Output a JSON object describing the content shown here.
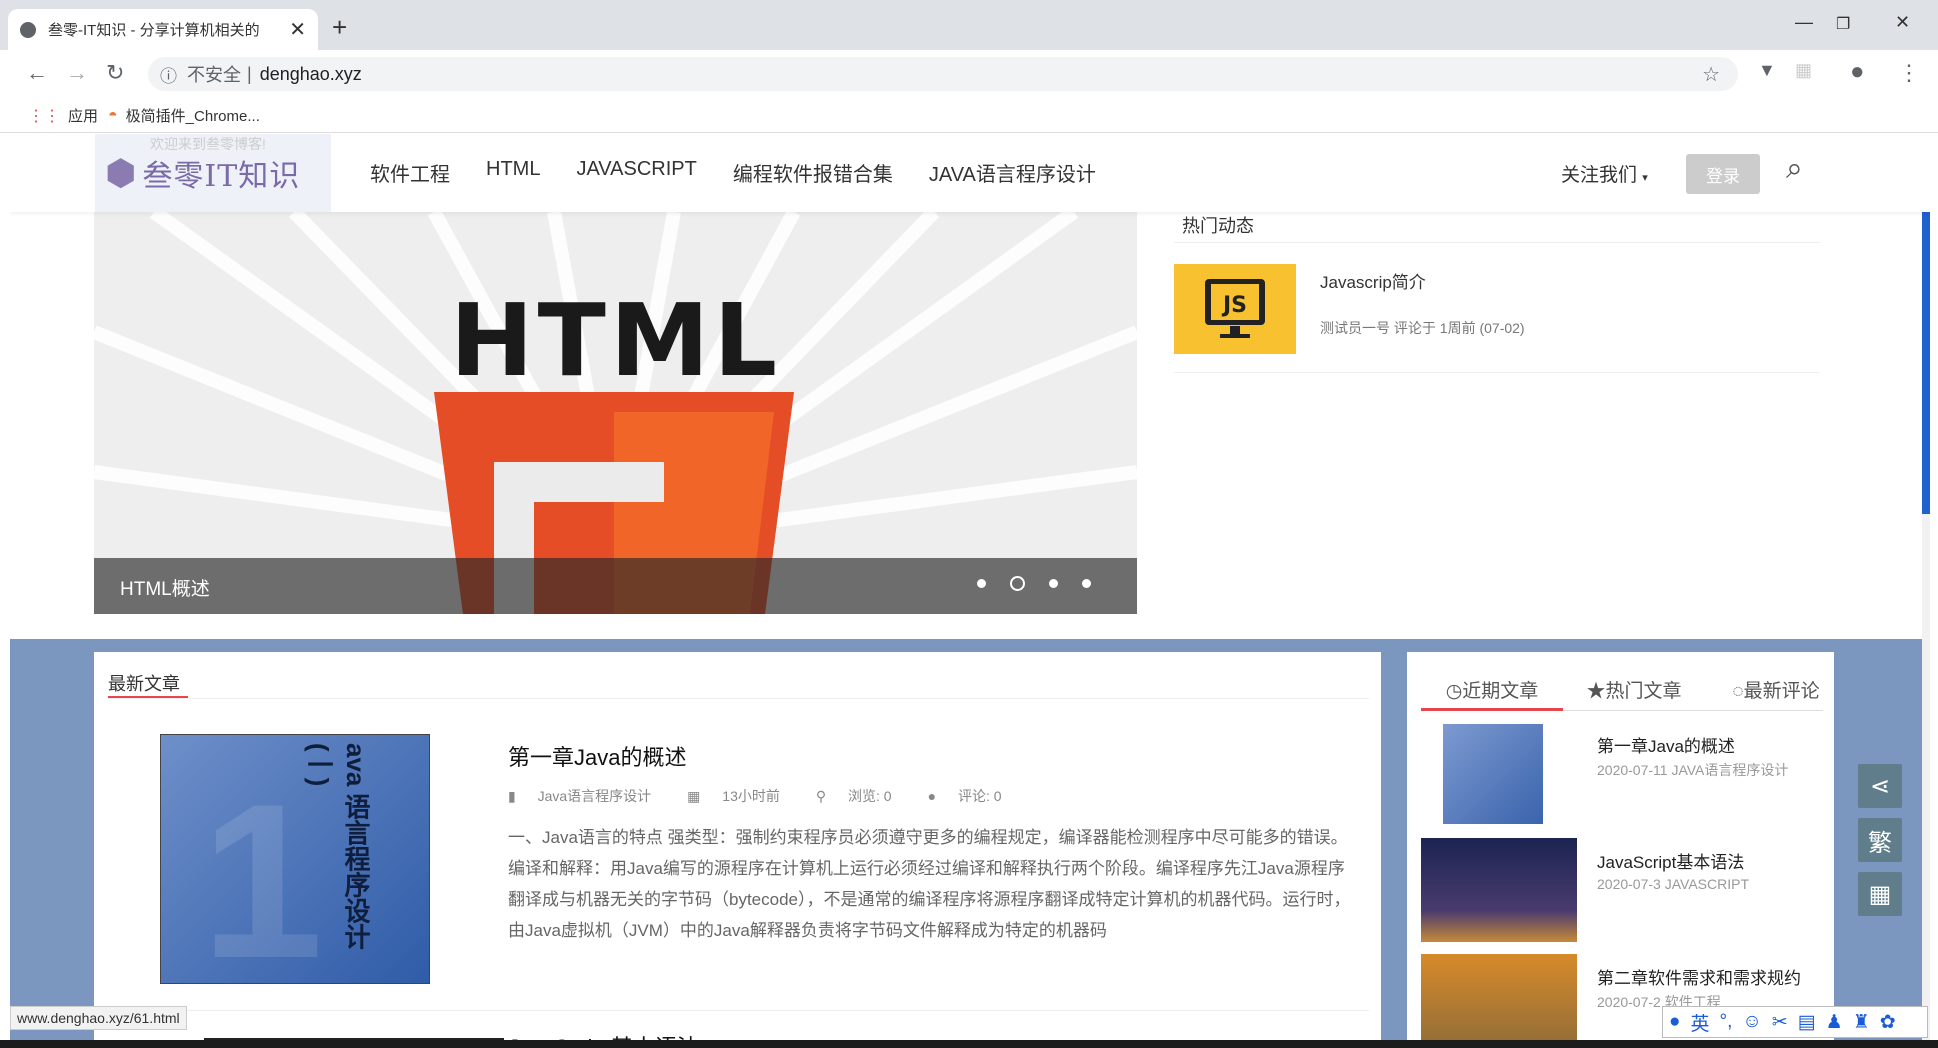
{
  "browser": {
    "tab_title": "叁零-IT知识 - 分享计算机相关的",
    "new_tab_icon": "+",
    "address_insecure": "不安全",
    "address_sep": "|",
    "url": "denghao.xyz",
    "bookmarks": [
      {
        "icon": "apps-grid-icon",
        "label": "应用"
      },
      {
        "icon": "rainbow-icon",
        "label": "极简插件_Chrome..."
      }
    ]
  },
  "site": {
    "logo_text": "叁零IT知识",
    "logo_welcome": "欢迎来到叁零博客!",
    "nav": [
      "软件工程",
      "HTML",
      "JAVASCRIPT",
      "编程软件报错合集",
      "JAVA语言程序设计"
    ],
    "follow": "关注我们",
    "login": "登录"
  },
  "slider": {
    "image_text": "HTML",
    "shield_number": "5",
    "caption": "HTML概述"
  },
  "hot": {
    "title": "热门动态",
    "item_title": "Javascrip简介",
    "item_meta": "测试员一号 评论于 1周前 (07-02)",
    "thumb_text": "JS"
  },
  "latest": {
    "title": "最新文章",
    "article": {
      "title": "第一章Java的概述",
      "category": "Java语言程序设计",
      "time": "13小时前",
      "views": "浏览: 0",
      "comments": "评论: 0",
      "excerpt": "一、Java语言的特点 强类型：强制约束程序员必须遵守更多的编程规定，编译器能检测程序中尽可能多的错误。 编译和解释：用Java编写的源程序在计算机上运行必须经过编译和解释执行两个阶段。编译程序先江Java源程序翻译成与机器无关的字节码（bytecode），不是通常的编译程序将源程序翻译成特定计算机的机器代码。运行时，由Java虚拟机（JVM）中的Java解释器负责将字节码文件解释成为特定的机器码",
      "thumb_text": "ava 语言程序设计(一)"
    },
    "article2_title": "JavaScript基本语法"
  },
  "sidebar": {
    "tabs": [
      "近期文章",
      "热门文章",
      "最新评论"
    ],
    "items": [
      {
        "title": "第一章Java的概述",
        "meta": "2020-07-11  JAVA语言程序设计"
      },
      {
        "title": "JavaScript基本语法",
        "meta": "2020-07-3  JAVASCRIPT"
      },
      {
        "title": "第二章软件需求和需求规约",
        "meta": "2020-07-2  软件工程"
      }
    ]
  },
  "float_buttons": [
    "share-icon",
    "繁",
    "grid-icon"
  ],
  "status_url": "www.denghao.xyz/61.html",
  "ime": [
    "英"
  ]
}
